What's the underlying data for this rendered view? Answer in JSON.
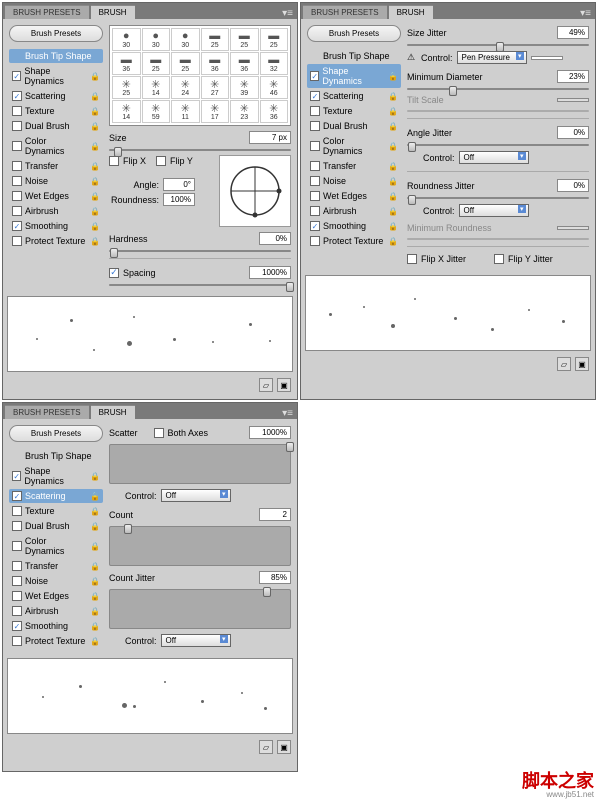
{
  "tabs": {
    "presets": "BRUSH PRESETS",
    "brush": "BRUSH"
  },
  "presetBtn": "Brush Presets",
  "sideItems": [
    {
      "id": "tip",
      "label": "Brush Tip Shape",
      "nocb": true
    },
    {
      "id": "dyn",
      "label": "Shape Dynamics",
      "chk": true,
      "lock": true
    },
    {
      "id": "scat",
      "label": "Scattering",
      "chk": true,
      "lock": true
    },
    {
      "id": "tex",
      "label": "Texture",
      "lock": true
    },
    {
      "id": "dual",
      "label": "Dual Brush",
      "lock": true
    },
    {
      "id": "col",
      "label": "Color Dynamics",
      "lock": true
    },
    {
      "id": "tran",
      "label": "Transfer",
      "lock": true
    },
    {
      "id": "noise",
      "label": "Noise",
      "lock": true
    },
    {
      "id": "wet",
      "label": "Wet Edges",
      "lock": true
    },
    {
      "id": "air",
      "label": "Airbrush",
      "lock": true
    },
    {
      "id": "smooth",
      "label": "Smoothing",
      "chk": true,
      "lock": true
    },
    {
      "id": "prot",
      "label": "Protect Texture",
      "lock": true
    }
  ],
  "p1": {
    "swatches": [
      [
        "●",
        "30"
      ],
      [
        "●",
        "30"
      ],
      [
        "●",
        "30"
      ],
      [
        "▬",
        "25"
      ],
      [
        "▬",
        "25"
      ],
      [
        "▬",
        "25"
      ],
      [
        "▬",
        "36"
      ],
      [
        "▬",
        "25"
      ],
      [
        "▬",
        "25"
      ],
      [
        "▬",
        "36"
      ],
      [
        "▬",
        "36"
      ],
      [
        "▬",
        "32"
      ],
      [
        "✳",
        "25"
      ],
      [
        "✳",
        "14"
      ],
      [
        "✳",
        "24"
      ],
      [
        "✳",
        "27"
      ],
      [
        "✳",
        "39"
      ],
      [
        "✳",
        "46"
      ],
      [
        "✳",
        "14"
      ],
      [
        "✳",
        "59"
      ],
      [
        "✳",
        "11"
      ],
      [
        "✳",
        "17"
      ],
      [
        "✳",
        "23"
      ],
      [
        "✳",
        "36"
      ]
    ],
    "size": {
      "label": "Size",
      "val": "7 px"
    },
    "flipx": "Flip X",
    "flipy": "Flip Y",
    "angle": {
      "label": "Angle:",
      "val": "0°"
    },
    "round": {
      "label": "Roundness:",
      "val": "100%"
    },
    "hard": {
      "label": "Hardness",
      "val": "0%"
    },
    "spacing": {
      "label": "Spacing",
      "val": "1000%",
      "chk": true
    }
  },
  "p2": {
    "sizeJitter": {
      "label": "Size Jitter",
      "val": "49%"
    },
    "control": {
      "label": "Control:",
      "val": "Pen Pressure"
    },
    "minDia": {
      "label": "Minimum Diameter",
      "val": "23%"
    },
    "tiltScale": "Tilt Scale",
    "angleJitter": {
      "label": "Angle Jitter",
      "val": "0%"
    },
    "control2": {
      "label": "Control:",
      "val": "Off"
    },
    "roundJitter": {
      "label": "Roundness Jitter",
      "val": "0%"
    },
    "control3": {
      "label": "Control:",
      "val": "Off"
    },
    "minRound": "Minimum Roundness",
    "flipXJ": "Flip X Jitter",
    "flipYJ": "Flip Y Jitter"
  },
  "p3": {
    "scatter": {
      "label": "Scatter",
      "both": "Both Axes",
      "val": "1000%"
    },
    "control": {
      "label": "Control:",
      "val": "Off"
    },
    "count": {
      "label": "Count",
      "val": "2"
    },
    "countJitter": {
      "label": "Count Jitter",
      "val": "85%"
    },
    "control2": {
      "label": "Control:",
      "val": "Off"
    }
  },
  "watermark": "脚本之家",
  "url": "www.jb51.net"
}
